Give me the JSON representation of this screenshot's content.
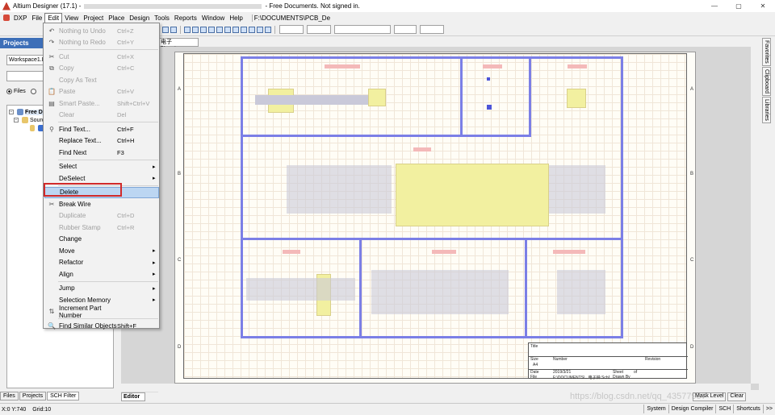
{
  "window": {
    "title_prefix": "Altium Designer (17.1) - ",
    "title_suffix": "- Free Documents. Not signed in.",
    "min": "—",
    "max": "▢",
    "close": "✕"
  },
  "menubar": {
    "items": [
      "DXP",
      "File",
      "Edit",
      "View",
      "Project",
      "Place",
      "Design",
      "Tools",
      "Reports",
      "Window",
      "Help"
    ],
    "active": "Edit",
    "path": "F:\\DOCUMENTS\\PCB_De"
  },
  "projects_panel": {
    "header": "Projects",
    "workspace": "Workspace1.D",
    "radio_files": "Files",
    "tree": {
      "root": "Free Do",
      "child": "Sourc"
    },
    "tabs": [
      "Files",
      "Projects",
      "SCH Filter"
    ]
  },
  "document_tab": "电子钟.SchDoc",
  "editor_tab": "Editor",
  "sheet": {
    "zones_left": [
      "A",
      "B",
      "C",
      "D"
    ],
    "zones_right": [
      "A",
      "B",
      "C",
      "D"
    ],
    "title_block": {
      "title": "Title",
      "size": "Size",
      "size_val": "A4",
      "number": "Number",
      "revision": "Revision",
      "date": "Date",
      "date_val": "2019/3/21",
      "sheet": "Sheet",
      "of": "of",
      "file": "File",
      "file_val": "F:\\DOCUMENTS\\...电子钟.SchDoc",
      "drawn_by": "Drawn By"
    }
  },
  "right_tabs": [
    "Favorites",
    "Clipboard",
    "Libraries"
  ],
  "right_bottom": [
    "Mask Level",
    "Clear"
  ],
  "edit_menu": [
    {
      "label": "Nothing to Undo",
      "shortcut": "Ctrl+Z",
      "disabled": true,
      "icon": "undo-icon",
      "glyph": "↶"
    },
    {
      "label": "Nothing to Redo",
      "shortcut": "Ctrl+Y",
      "disabled": true,
      "icon": "redo-icon",
      "glyph": "↷"
    },
    {
      "sep": true
    },
    {
      "label": "Cut",
      "shortcut": "Ctrl+X",
      "disabled": true,
      "icon": "cut-icon",
      "glyph": "✂"
    },
    {
      "label": "Copy",
      "shortcut": "Ctrl+C",
      "disabled": true,
      "icon": "copy-icon",
      "glyph": "⧉"
    },
    {
      "label": "Copy As Text",
      "shortcut": "",
      "disabled": true
    },
    {
      "label": "Paste",
      "shortcut": "Ctrl+V",
      "disabled": true,
      "icon": "paste-icon",
      "glyph": "📋"
    },
    {
      "label": "Smart Paste...",
      "shortcut": "Shift+Ctrl+V",
      "disabled": true,
      "icon": "smart-paste-icon",
      "glyph": "▤"
    },
    {
      "label": "Clear",
      "shortcut": "Del",
      "disabled": true
    },
    {
      "sep": true
    },
    {
      "label": "Find Text...",
      "shortcut": "Ctrl+F",
      "disabled": false,
      "icon": "binoculars-icon",
      "glyph": "⚲"
    },
    {
      "label": "Replace Text...",
      "shortcut": "Ctrl+H",
      "disabled": false
    },
    {
      "label": "Find Next",
      "shortcut": "F3",
      "disabled": false
    },
    {
      "sep": true
    },
    {
      "label": "Select",
      "shortcut": "",
      "submenu": true
    },
    {
      "label": "DeSelect",
      "shortcut": "",
      "submenu": true
    },
    {
      "sep": true
    },
    {
      "label": "Delete",
      "shortcut": "",
      "highlighted": true
    },
    {
      "label": "Break Wire",
      "shortcut": "",
      "icon": "break-wire-icon",
      "glyph": "✂"
    },
    {
      "label": "Duplicate",
      "shortcut": "Ctrl+D",
      "disabled": true
    },
    {
      "label": "Rubber Stamp",
      "shortcut": "Ctrl+R",
      "disabled": true
    },
    {
      "label": "Change",
      "shortcut": ""
    },
    {
      "label": "Move",
      "shortcut": "",
      "submenu": true
    },
    {
      "label": "Refactor",
      "shortcut": "",
      "submenu": true
    },
    {
      "label": "Align",
      "shortcut": "",
      "submenu": true
    },
    {
      "sep": true
    },
    {
      "label": "Jump",
      "shortcut": "",
      "submenu": true
    },
    {
      "label": "Selection Memory",
      "shortcut": "",
      "submenu": true
    },
    {
      "label": "Increment Part Number",
      "shortcut": "",
      "icon": "increment-icon",
      "glyph": "⇅"
    },
    {
      "sep": true
    },
    {
      "label": "Find Similar Objects",
      "shortcut": "Shift+F",
      "icon": "find-similar-icon",
      "glyph": "🔍"
    }
  ],
  "statusbar": {
    "coords": "X:0 Y:740",
    "grid": "Grid:10",
    "buttons": [
      "System",
      "Design Compiler",
      "SCH",
      "Shortcuts",
      ">>"
    ]
  },
  "watermark": "https://blog.csdn.net/qq_43577957",
  "colors": {
    "panel_header": "#3d6fb8",
    "sheet_border": "#7b7fe6",
    "highlight": "#bcd6f2",
    "red_frame": "#d12a2a"
  }
}
